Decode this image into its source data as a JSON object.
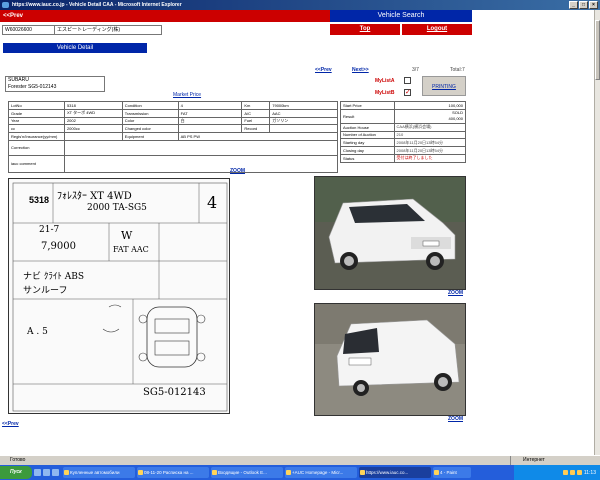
{
  "window": {
    "title": "https://www.iauc.co.jp - Vehicle Detail CAA - Microsoft Internet Explorer"
  },
  "header": {
    "prev": "<<Prev",
    "vehicle_search": "Vehicle Search",
    "top": "Top",
    "logout": "Logout"
  },
  "vehicle": {
    "id": "W60026600",
    "dealer": "エスピートレーディング(株)",
    "detail_title": "Vehicle Detail",
    "name_line1": "SUBARU",
    "name_line2": "Forester SG5-012143",
    "market_price": "Market Price"
  },
  "pager": {
    "prev": "<<Prev",
    "next": "Next>>",
    "position": "3/7",
    "total": "Total:7"
  },
  "mylist": {
    "a_label": "MyListA",
    "a_checked": false,
    "b_label": "MyListB",
    "b_checked": true,
    "print": "PRINTING"
  },
  "spec": {
    "lotno_label": "LotNo",
    "lotno": "5318",
    "condition_label": "Condition",
    "condition": "4",
    "km_label": "Km",
    "km": "79000km",
    "grade_label": "Grade",
    "grade": "XT ターボ 4WD",
    "transmission_label": "Transmission",
    "transmission": "FAT",
    "ac_label": "A/C",
    "ac": "AAC",
    "year_label": "Year",
    "year": "2002",
    "color_label": "Color",
    "color": "白",
    "fuel_label": "Fuel",
    "fuel": "ガソリン",
    "cc_label": "cc",
    "cc": "2000cc",
    "changed_color_label": "Changed color",
    "changed_color": "",
    "record_label": "Record",
    "record": "",
    "regis_label": "Regis'n/Insurance(yy/mm)",
    "regis": "",
    "equipment_label": "Equipment",
    "equipment": "AB PS PW",
    "correction_label": "Correction",
    "correction": "",
    "comment_label": "iauc comment",
    "comment": ""
  },
  "auction": {
    "start_price_label": "Start Price",
    "start_price": "100,000",
    "result_label": "Result",
    "result_1": "SOLD",
    "result_2": "400,000",
    "house_label": "Auction House",
    "house": "CAA横浜(横浜会場)",
    "number_label": "Number of Auction",
    "number": "210",
    "starting_day_label": "Starting day",
    "starting_day": "2008年11月20日13時54分",
    "closing_day_label": "Closing day",
    "closing_day": "2008年11月20日13時54分",
    "status_label": "Status",
    "status": "受付は終了しました"
  },
  "sheet": {
    "lot": "5318",
    "grade_hand": "ﾌｫﾚｽﾀｰ XT 4WD",
    "model_hand": "2000 TA-SG5",
    "score": "4",
    "date_hand": "21-7",
    "km_hand": "7,9000",
    "color_hand": "W",
    "trans_hand": "FAT AAC",
    "notes_1": "ナビ ｸﾗｲﾄ ABS",
    "notes_2": "サンルーフ",
    "chassis": "SG5-012143",
    "frame_hand": "A . 5"
  },
  "links": {
    "zoom": "ZOOM",
    "prev_bottom": "<<Prev"
  },
  "statusbar": {
    "left": "Готово",
    "right": "Интернет"
  },
  "taskbar": {
    "start": "Пуск",
    "tasks": [
      "Купленные автомобили",
      "08-11-20 Расписка на ...",
      "Входящие - Outlook E...",
      "+AUC Homepage - Micr...",
      "https://www.iauc.co...",
      "4 - Paint"
    ],
    "clock": "11:13"
  }
}
